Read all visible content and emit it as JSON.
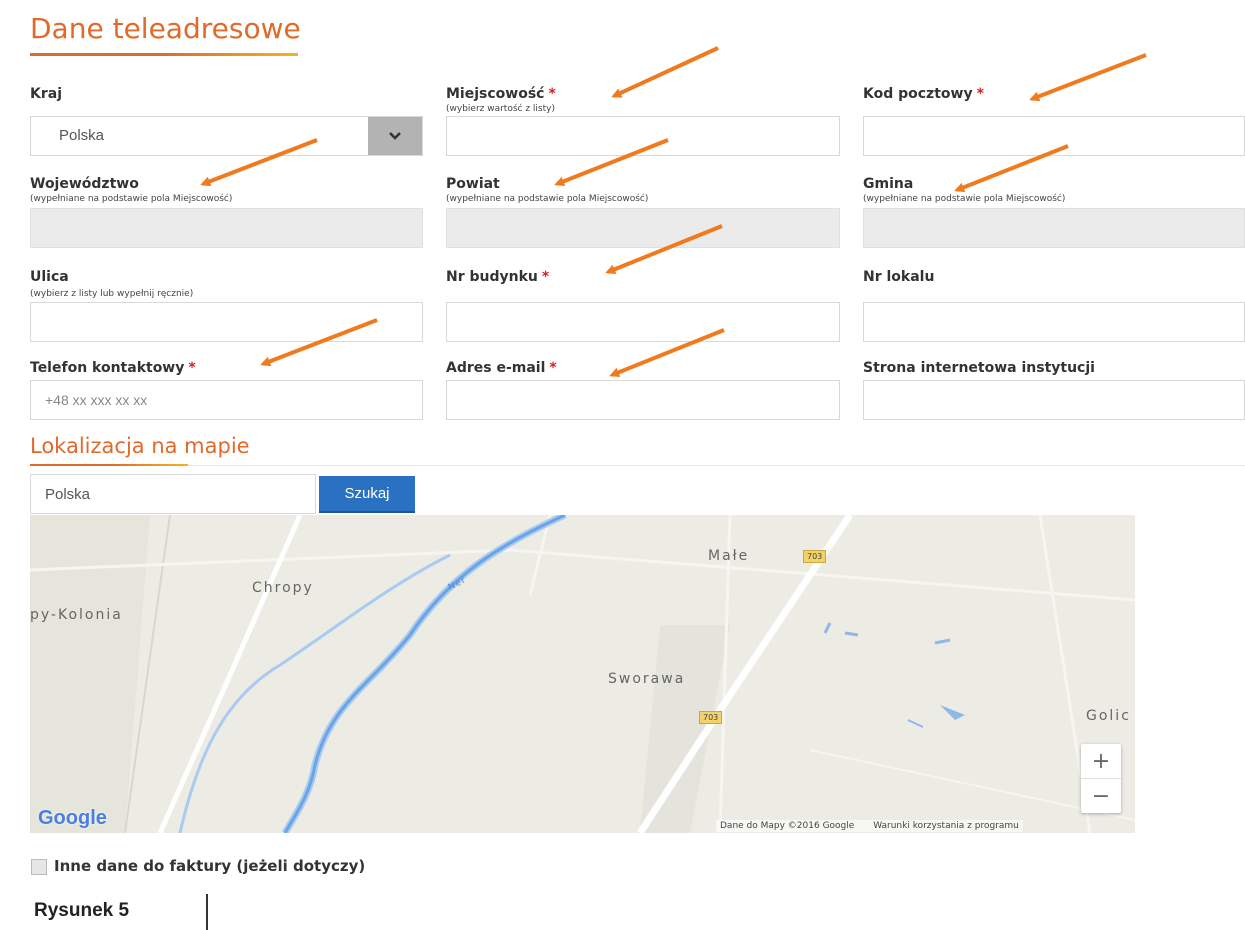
{
  "section_title": "Dane teleadresowe",
  "fields": {
    "kraj": {
      "label": "Kraj",
      "value": "Polska"
    },
    "miejscowosc": {
      "label": "Miejscowość",
      "required": "*",
      "hint": "(wybierz wartość z listy)",
      "value": ""
    },
    "kod_pocztowy": {
      "label": "Kod pocztowy",
      "required": "*",
      "value": ""
    },
    "wojewodztwo": {
      "label": "Województwo",
      "hint": "(wypełniane na podstawie pola Miejscowość)",
      "value": ""
    },
    "powiat": {
      "label": "Powiat",
      "hint": "(wypełniane na podstawie pola Miejscowość)",
      "value": ""
    },
    "gmina": {
      "label": "Gmina",
      "hint": "(wypełniane na podstawie pola Miejscowość)",
      "value": ""
    },
    "ulica": {
      "label": "Ulica",
      "hint": "(wybierz z listy lub wypełnij ręcznie)",
      "value": ""
    },
    "nr_budynku": {
      "label": "Nr budynku",
      "required": "*",
      "value": ""
    },
    "nr_lokalu": {
      "label": "Nr lokalu",
      "value": ""
    },
    "telefon": {
      "label": "Telefon kontaktowy",
      "required": "*",
      "placeholder": "+48 xx xxx xx xx",
      "value": ""
    },
    "email": {
      "label": "Adres e-mail",
      "required": "*",
      "value": ""
    },
    "strona": {
      "label": "Strona internetowa instytucji",
      "value": ""
    }
  },
  "map_section": {
    "title": "Lokalizacja na mapie",
    "search_value": "Polska",
    "search_button": "Szukaj"
  },
  "map": {
    "labels": {
      "male": "Małe",
      "chropy": "Chropy",
      "kolonia": "py-Kolonia",
      "sworawa": "Sworawa",
      "golic": "Golic",
      "river": "Ner"
    },
    "road_number": "703",
    "google_logo": "Google",
    "attribution": "Dane do Mapy ©2016 Google",
    "terms": "Warunki korzystania z programu",
    "zoom_in": "+",
    "zoom_out": "−"
  },
  "invoice_checkbox": {
    "label": "Inne dane do faktury (jeżeli dotyczy)",
    "checked": false
  },
  "caption": "Rysunek 5",
  "colors": {
    "accent": "#e06a2c",
    "arrow": "#f07a1e",
    "button": "#2a72c1",
    "required": "#d81e1e"
  }
}
